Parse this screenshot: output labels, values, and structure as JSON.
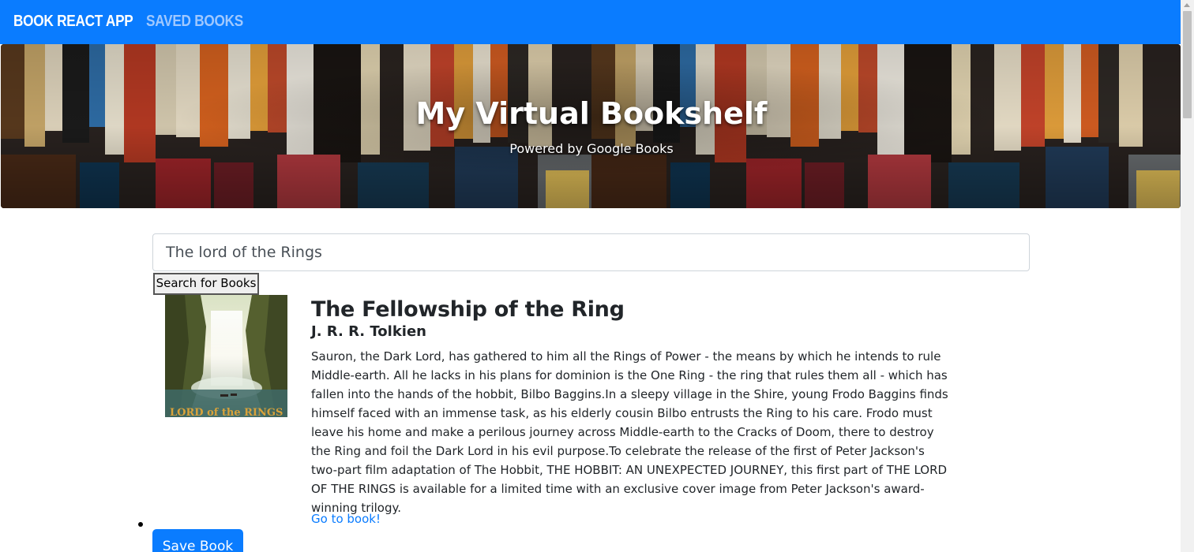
{
  "navbar": {
    "brand": "BOOK REACT APP",
    "saved_link": "SAVED BOOKS",
    "color": "#0a7cff"
  },
  "hero": {
    "title": "My Virtual Bookshelf",
    "subtitle": "Powered by Google Books"
  },
  "search": {
    "value": "The lord of the Rings",
    "button_label": "Search for Books"
  },
  "results": [
    {
      "title": "The Fellowship of the Ring",
      "author": "J. R. R. Tolkien",
      "description": "Sauron, the Dark Lord, has gathered to him all the Rings of Power - the means by which he intends to rule Middle-earth. All he lacks in his plans for dominion is the One Ring - the ring that rules them all - which has fallen into the hands of the hobbit, Bilbo Baggins.In a sleepy village in the Shire, young Frodo Baggins finds himself faced with an immense task, as his elderly cousin Bilbo entrusts the Ring to his care. Frodo must leave his home and make a perilous journey across Middle-earth to the Cracks of Doom, there to destroy the Ring and foil the Dark Lord in his evil purpose.To celebrate the release of the first of Peter Jackson's two-part film adaptation of The Hobbit, THE HOBBIT: AN UNEXPECTED JOURNEY, this first part of THE LORD OF THE RINGS is available for a limited time with an exclusive cover image from Peter Jackson's award-winning trilogy.",
      "link_label": "Go to book!",
      "save_label": "Save Book",
      "cover_text": "LORD of the RINGS"
    }
  ],
  "colors": {
    "accent": "#0a7cff",
    "link": "#0a7cff",
    "text": "#212529"
  }
}
